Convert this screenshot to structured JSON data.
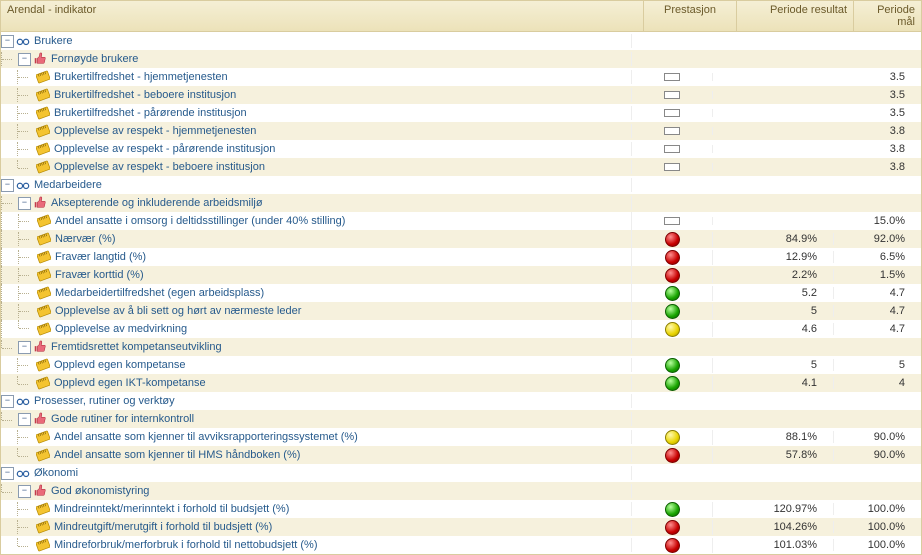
{
  "header": {
    "c1": "Arendal - indikator",
    "c2": "Prestasjon",
    "c3": "Periode resultat",
    "c4": "Periode mål"
  },
  "icons": {
    "glasses": "glasses-icon",
    "thumb": "thumb-up-icon",
    "ruler": "ruler-icon"
  },
  "rows": [
    {
      "depth": 0,
      "type": "section",
      "pm": "-",
      "icon": "glasses",
      "label": "Brukere"
    },
    {
      "depth": 1,
      "type": "group",
      "pm": "-",
      "icon": "thumb",
      "label": "Fornøyde brukere"
    },
    {
      "depth": 2,
      "type": "leaf",
      "icon": "ruler",
      "label": "Brukertilfredshet - hjemmetjenesten",
      "status": "none",
      "result": "",
      "goal": "3.5"
    },
    {
      "depth": 2,
      "type": "leaf",
      "icon": "ruler",
      "label": "Brukertilfredshet - beboere institusjon",
      "status": "none",
      "result": "",
      "goal": "3.5"
    },
    {
      "depth": 2,
      "type": "leaf",
      "icon": "ruler",
      "label": "Brukertilfredshet - pårørende institusjon",
      "status": "none",
      "result": "",
      "goal": "3.5"
    },
    {
      "depth": 2,
      "type": "leaf",
      "icon": "ruler",
      "label": "Opplevelse av respekt - hjemmetjenesten",
      "status": "none",
      "result": "",
      "goal": "3.8"
    },
    {
      "depth": 2,
      "type": "leaf",
      "icon": "ruler",
      "label": "Opplevelse av respekt - pårørende institusjon",
      "status": "none",
      "result": "",
      "goal": "3.8"
    },
    {
      "depth": 2,
      "type": "leaf",
      "icon": "ruler",
      "label": "Opplevelse av respekt - beboere institusjon",
      "status": "none",
      "result": "",
      "goal": "3.8",
      "last": true
    },
    {
      "depth": 0,
      "type": "section",
      "pm": "-",
      "icon": "glasses",
      "label": "Medarbeidere"
    },
    {
      "depth": 1,
      "type": "group",
      "pm": "-",
      "icon": "thumb",
      "label": "Aksepterende og inkluderende arbeidsmiljø"
    },
    {
      "depth": 2,
      "type": "leaf",
      "icon": "ruler",
      "label": "Andel ansatte i omsorg i deltidsstillinger (under 40% stilling)",
      "status": "none",
      "result": "",
      "goal": "15.0%",
      "parentHasMore": true
    },
    {
      "depth": 2,
      "type": "leaf",
      "icon": "ruler",
      "label": "Nærvær (%)",
      "status": "red",
      "result": "84.9%",
      "goal": "92.0%",
      "parentHasMore": true
    },
    {
      "depth": 2,
      "type": "leaf",
      "icon": "ruler",
      "label": "Fravær langtid (%)",
      "status": "red",
      "result": "12.9%",
      "goal": "6.5%",
      "parentHasMore": true
    },
    {
      "depth": 2,
      "type": "leaf",
      "icon": "ruler",
      "label": "Fravær korttid (%)",
      "status": "red",
      "result": "2.2%",
      "goal": "1.5%",
      "parentHasMore": true
    },
    {
      "depth": 2,
      "type": "leaf",
      "icon": "ruler",
      "label": "Medarbeidertilfredshet (egen arbeidsplass)",
      "status": "green",
      "result": "5.2",
      "goal": "4.7",
      "parentHasMore": true
    },
    {
      "depth": 2,
      "type": "leaf",
      "icon": "ruler",
      "label": "Opplevelse av å bli sett og hørt av nærmeste leder",
      "status": "green",
      "result": "5",
      "goal": "4.7",
      "parentHasMore": true
    },
    {
      "depth": 2,
      "type": "leaf",
      "icon": "ruler",
      "label": "Opplevelse av medvirkning",
      "status": "yellow",
      "result": "4.6",
      "goal": "4.7",
      "last": true,
      "parentHasMore": true
    },
    {
      "depth": 1,
      "type": "group",
      "pm": "-",
      "icon": "thumb",
      "label": "Fremtidsrettet kompetanseutvikling",
      "last": true
    },
    {
      "depth": 2,
      "type": "leaf",
      "icon": "ruler",
      "label": "Opplevd egen kompetanse",
      "status": "green",
      "result": "5",
      "goal": "5"
    },
    {
      "depth": 2,
      "type": "leaf",
      "icon": "ruler",
      "label": "Opplevd egen IKT-kompetanse",
      "status": "green",
      "result": "4.1",
      "goal": "4",
      "last": true
    },
    {
      "depth": 0,
      "type": "section",
      "pm": "-",
      "icon": "glasses",
      "label": "Prosesser, rutiner og verktøy"
    },
    {
      "depth": 1,
      "type": "group",
      "pm": "-",
      "icon": "thumb",
      "label": "Gode rutiner for internkontroll",
      "last": true
    },
    {
      "depth": 2,
      "type": "leaf",
      "icon": "ruler",
      "label": "Andel ansatte som kjenner til avviksrapporteringssystemet (%)",
      "status": "yellow",
      "result": "88.1%",
      "goal": "90.0%"
    },
    {
      "depth": 2,
      "type": "leaf",
      "icon": "ruler",
      "label": "Andel ansatte som kjenner til HMS håndboken (%)",
      "status": "red",
      "result": "57.8%",
      "goal": "90.0%",
      "last": true
    },
    {
      "depth": 0,
      "type": "section",
      "pm": "-",
      "icon": "glasses",
      "label": "Økonomi"
    },
    {
      "depth": 1,
      "type": "group",
      "pm": "-",
      "icon": "thumb",
      "label": "God økonomistyring",
      "last": true
    },
    {
      "depth": 2,
      "type": "leaf",
      "icon": "ruler",
      "label": "Mindreinntekt/merinntekt i forhold til budsjett (%)",
      "status": "green",
      "result": "120.97%",
      "goal": "100.0%"
    },
    {
      "depth": 2,
      "type": "leaf",
      "icon": "ruler",
      "label": "Mindreutgift/merutgift i forhold til budsjett (%)",
      "status": "red",
      "result": "104.26%",
      "goal": "100.0%"
    },
    {
      "depth": 2,
      "type": "leaf",
      "icon": "ruler",
      "label": "Mindreforbruk/merforbruk i forhold til nettobudsjett (%)",
      "status": "red",
      "result": "101.03%",
      "goal": "100.0%",
      "last": true
    }
  ]
}
